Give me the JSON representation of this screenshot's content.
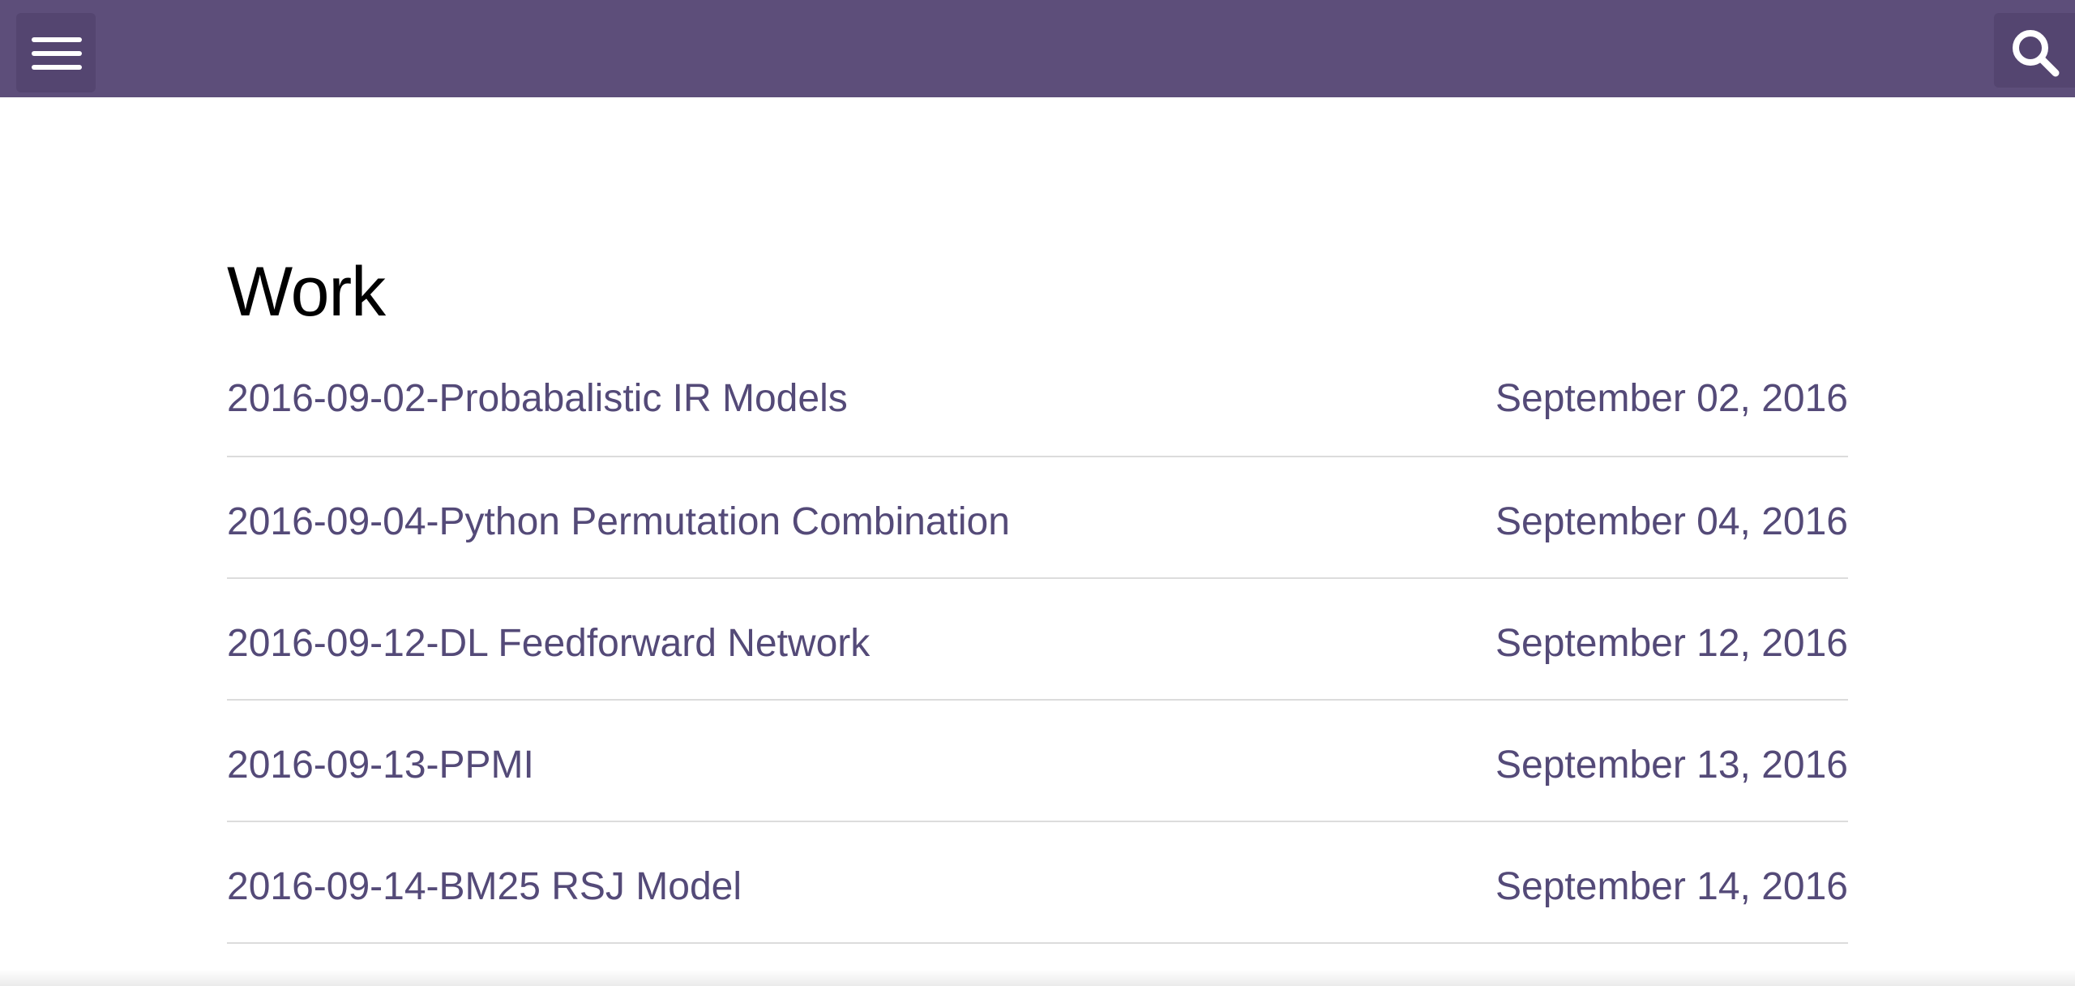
{
  "header": {
    "menu_icon": "hamburger-menu-icon",
    "search_icon": "search-icon",
    "background_color": "#5d4e7a"
  },
  "main": {
    "title": "Work",
    "posts": [
      {
        "title": "2016-09-02-Probabalistic IR Models",
        "date": "September 02, 2016"
      },
      {
        "title": "2016-09-04-Python Permutation Combination",
        "date": "September 04, 2016"
      },
      {
        "title": "2016-09-12-DL Feedforward Network",
        "date": "September 12, 2016"
      },
      {
        "title": "2016-09-13-PPMI",
        "date": "September 13, 2016"
      },
      {
        "title": "2016-09-14-BM25 RSJ Model",
        "date": "September 14, 2016"
      }
    ],
    "link_color": "#544a78"
  }
}
